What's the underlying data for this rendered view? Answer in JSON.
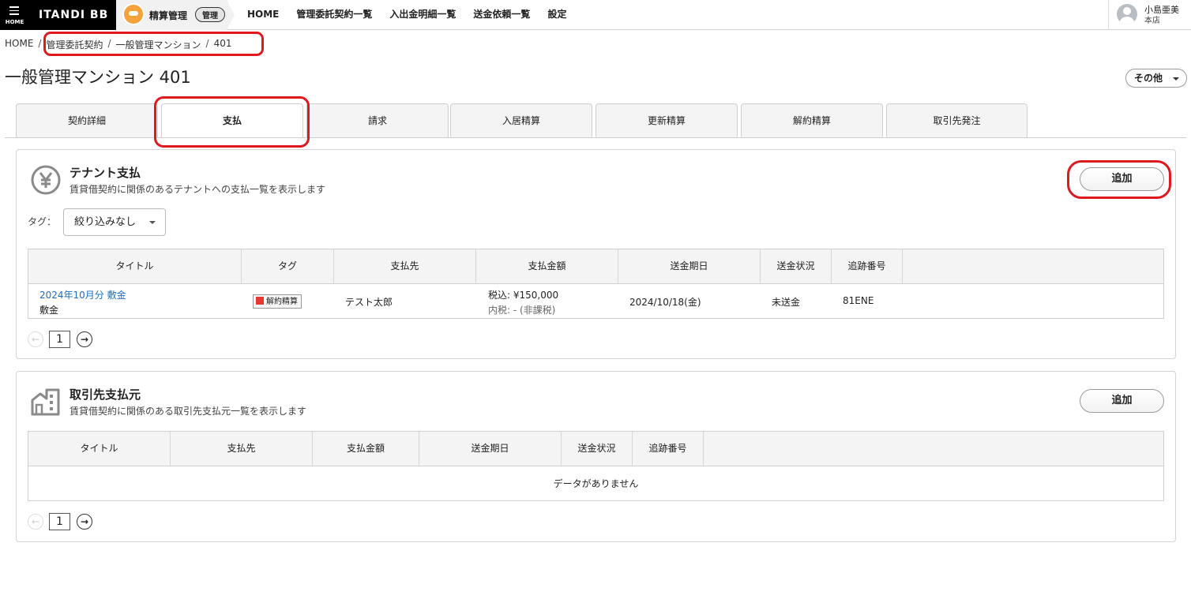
{
  "header": {
    "home_label": "HOME",
    "brand": "ITANDI BB",
    "app_name": "精算管理",
    "app_badge": "管理",
    "nav": [
      "HOME",
      "管理委託契約一覧",
      "入出金明細一覧",
      "送金依頼一覧",
      "設定"
    ],
    "user_name": "小島亜美",
    "user_branch": "本店"
  },
  "breadcrumb": {
    "home": "HOME",
    "items": [
      "管理委託契約",
      "一般管理マンション",
      "401"
    ],
    "separator": "/"
  },
  "page_title": "一般管理マンション 401",
  "other_button": "その他",
  "tabs": [
    "契約詳細",
    "支払",
    "請求",
    "入居精算",
    "更新精算",
    "解約精算",
    "取引先発注"
  ],
  "tenant_section": {
    "icon": "yen-icon",
    "title": "テナント支払",
    "description": "賃貸借契約に関係のあるテナントへの支払一覧を表示します",
    "add_label": "追加",
    "tag_label": "タグ：",
    "tag_filter": "絞り込みなし",
    "columns": [
      "タイトル",
      "タグ",
      "支払先",
      "支払金額",
      "送金期日",
      "送金状況",
      "追跡番号"
    ],
    "rows": [
      {
        "title": "2024年10月分 敷金",
        "subtitle": "敷金",
        "tag": "解約精算",
        "payee": "テスト太郎",
        "amount": "税込: ¥150,000",
        "tax_note": "内税: - (非課税)",
        "due_date": "2024/10/18(金)",
        "status": "未送金",
        "tracking": "81ENE"
      }
    ],
    "page": "1"
  },
  "vendor_section": {
    "icon": "building-icon",
    "title": "取引先支払元",
    "description": "賃貸借契約に関係のある取引先支払元一覧を表示します",
    "add_label": "追加",
    "columns": [
      "タイトル",
      "支払先",
      "支払金額",
      "送金期日",
      "送金状況",
      "追跡番号"
    ],
    "empty_text": "データがありません",
    "page": "1"
  },
  "colors": {
    "highlight": "#e0191e",
    "link": "#1a6fc4",
    "tag_red": "#e53935"
  }
}
